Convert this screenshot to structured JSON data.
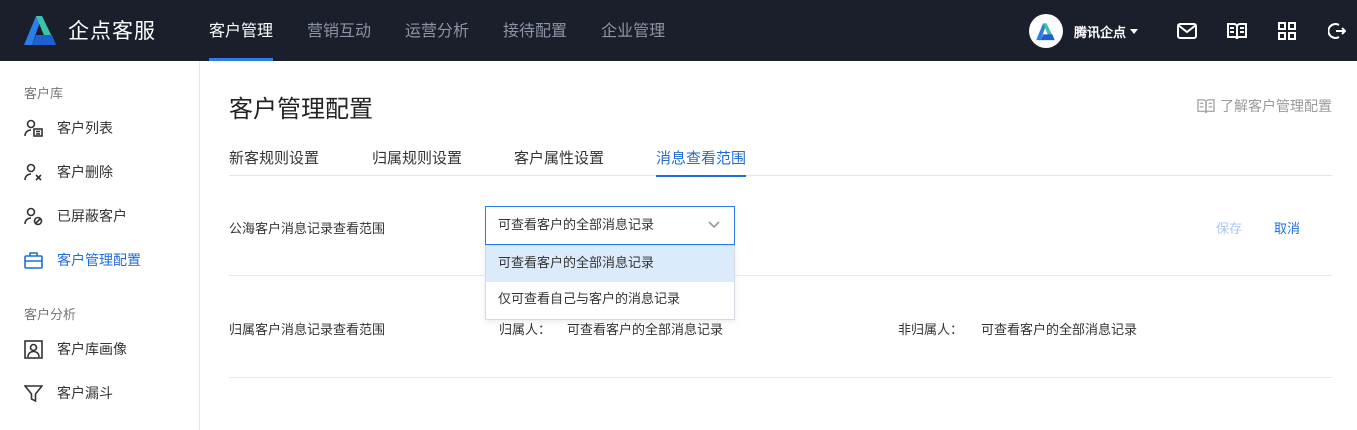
{
  "brand": {
    "name": "企点客服",
    "accent": "#2b7de9",
    "header_bg": "#1b1f2b"
  },
  "nav": [
    {
      "label": "客户管理",
      "active": true
    },
    {
      "label": "营销互动",
      "active": false
    },
    {
      "label": "运营分析",
      "active": false
    },
    {
      "label": "接待配置",
      "active": false
    },
    {
      "label": "企业管理",
      "active": false
    }
  ],
  "user": {
    "name": "腾讯企点"
  },
  "header_icons": [
    "mail-icon",
    "book-icon",
    "apps-grid-icon",
    "logout-icon"
  ],
  "sidebar": {
    "groups": [
      {
        "title": "客户库",
        "items": [
          {
            "label": "客户列表",
            "icon": "customer-list-icon"
          },
          {
            "label": "客户删除",
            "icon": "user-remove-icon"
          },
          {
            "label": "已屏蔽客户",
            "icon": "user-blocked-icon"
          },
          {
            "label": "客户管理配置",
            "icon": "briefcase-icon",
            "active": true
          }
        ]
      },
      {
        "title": "客户分析",
        "items": [
          {
            "label": "客户库画像",
            "icon": "portrait-icon"
          },
          {
            "label": "客户漏斗",
            "icon": "funnel-icon"
          }
        ]
      }
    ]
  },
  "page": {
    "title": "客户管理配置",
    "help_link": "了解客户管理配置",
    "tabs": [
      {
        "label": "新客规则设置"
      },
      {
        "label": "归属规则设置"
      },
      {
        "label": "客户属性设置"
      },
      {
        "label": "消息查看范围",
        "active": true
      }
    ]
  },
  "public_sea": {
    "label": "公海客户消息记录查看范围",
    "selected": "可查看客户的全部消息记录",
    "options": [
      "可查看客户的全部消息记录",
      "仅可查看自己与客户的消息记录"
    ],
    "save": "保存",
    "cancel": "取消"
  },
  "owned": {
    "label": "归属客户消息记录查看范围",
    "owner_key": "归属人：",
    "owner_value": "可查看客户的全部消息记录",
    "non_owner_key": "非归属人：",
    "non_owner_value": "可查看客户的全部消息记录"
  }
}
